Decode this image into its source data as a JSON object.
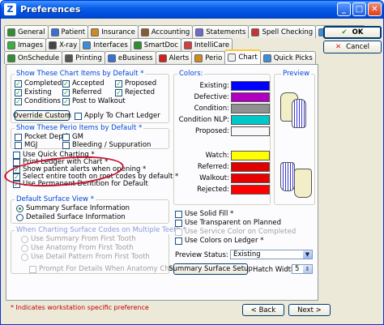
{
  "window": {
    "title": "Preferences",
    "icon_text": "Z"
  },
  "tabs_row1": [
    {
      "label": "General",
      "icon": "general-icon",
      "color": "#2f8f2f"
    },
    {
      "label": "Patient",
      "icon": "patient-icon",
      "color": "#3b6fd8"
    },
    {
      "label": "Insurance",
      "icon": "insurance-icon",
      "color": "#d08a20"
    },
    {
      "label": "Accounting",
      "icon": "accounting-icon",
      "color": "#8a5a2a"
    },
    {
      "label": "Statements",
      "icon": "statements-icon",
      "color": "#6b6bd0"
    },
    {
      "label": "Spell Checking",
      "icon": "spell-check-icon",
      "color": "#c83232"
    },
    {
      "label": "Employer",
      "icon": "employer-icon",
      "color": "#3b8fd8"
    }
  ],
  "tabs_row2": [
    {
      "label": "Images",
      "icon": "images-icon",
      "color": "#3bb03b"
    },
    {
      "label": "X-ray",
      "icon": "xray-icon",
      "color": "#444444"
    },
    {
      "label": "Interfaces",
      "icon": "interfaces-icon",
      "color": "#3b8fd8"
    },
    {
      "label": "SmartDoc",
      "icon": "smartdoc-icon",
      "color": "#2f8f2f"
    },
    {
      "label": "IntelliCare",
      "icon": "intellicare-icon",
      "color": "#d04040"
    }
  ],
  "tabs_row3": [
    {
      "label": "OnSchedule",
      "icon": "onschedule-icon",
      "color": "#2f8f2f"
    },
    {
      "label": "Printing",
      "icon": "printer-icon",
      "color": "#555555"
    },
    {
      "label": "eBusiness",
      "icon": "ebusiness-icon",
      "color": "#3b6fd8"
    },
    {
      "label": "Alerts",
      "icon": "alert-icon",
      "color": "#d02020"
    },
    {
      "label": "Perio",
      "icon": "perio-icon",
      "color": "#d08a20"
    },
    {
      "label": "Chart",
      "icon": "chart-icon",
      "color": "#f0f0f0"
    },
    {
      "label": "Quick Picks",
      "icon": "quick-picks-icon",
      "color": "#3b8fd8"
    }
  ],
  "chart_items": {
    "title": "Show These Chart Items by Default *",
    "items": [
      {
        "label": "Completed",
        "checked": true
      },
      {
        "label": "Accepted",
        "checked": true
      },
      {
        "label": "Proposed",
        "checked": true
      },
      {
        "label": "Existing",
        "checked": true
      },
      {
        "label": "Referred",
        "checked": true
      },
      {
        "label": "Rejected",
        "checked": true
      },
      {
        "label": "Conditions",
        "checked": true
      },
      {
        "label": "Post to Walkout",
        "checked": true
      }
    ],
    "override_label": "Override Custom",
    "apply_label": "Apply To Chart Ledger"
  },
  "perio_items": {
    "title": "Show These Perio Items by Default *",
    "items": [
      {
        "label": "Pocket Depth"
      },
      {
        "label": "GM"
      },
      {
        "label": "MGJ"
      },
      {
        "label": "Bleeding / Suppuration"
      }
    ]
  },
  "options": [
    {
      "label": "Use Quick Charting *",
      "checked": false
    },
    {
      "label": "Print Ledger with Chart *",
      "checked": false
    },
    {
      "label": "Show patient alerts when opening *",
      "checked": true
    },
    {
      "label": "Select entire tooth on root codes by default *",
      "checked": true
    },
    {
      "label": "Use Permanent Dentition for Default",
      "checked": true
    }
  ],
  "surface_view": {
    "title": "Default Surface View *",
    "options": [
      {
        "label": "Summary Surface Information",
        "selected": true
      },
      {
        "label": "Detailed Surface Information",
        "selected": false
      }
    ]
  },
  "multi_teeth": {
    "title": "When Charting Surface Codes on Multiple Teeth *",
    "options": [
      {
        "label": "Use Summary From First Tooth"
      },
      {
        "label": "Use Anatomy From First Tooth"
      },
      {
        "label": "Use Detail Pattern From First Tooth"
      }
    ],
    "prompt_label": "Prompt For Details When Anatomy Changes"
  },
  "colors": {
    "title": "Colors:",
    "items": [
      {
        "label": "Existing:",
        "color": "#0000ff"
      },
      {
        "label": "Defective:",
        "color": "#b000c0"
      },
      {
        "label": "Condition:",
        "color": "#909090"
      },
      {
        "label": "Condition NLP:",
        "color": "#00c8c8"
      },
      {
        "label": "Proposed:",
        "color": "#f8f8f8"
      },
      {
        "label": "Watch:",
        "color": "#ffff00"
      },
      {
        "label": "Referred:",
        "color": "#e00000"
      },
      {
        "label": "Walkout:",
        "color": "#e80000"
      },
      {
        "label": "Rejected:",
        "color": "#ff0000"
      }
    ]
  },
  "preview_label": "Preview",
  "bottom_checks": [
    {
      "label": "Use Solid Fill *",
      "checked": false,
      "disabled": false
    },
    {
      "label": "Use Transparent on Planned",
      "checked": false,
      "disabled": false
    },
    {
      "label": "Use Service Color on Completed",
      "checked": false,
      "disabled": true
    },
    {
      "label": "Use Colors on Ledger *",
      "checked": false,
      "disabled": false
    }
  ],
  "preview_status": {
    "label": "Preview Status:",
    "value": "Existing"
  },
  "summary_button": "Summary Surface Setup",
  "hatch": {
    "label": "Hatch Width:",
    "value": "5"
  },
  "footnote": "* Indicates workstation specific preference",
  "buttons": {
    "ok": "OK",
    "cancel": "Cancel",
    "back": "< Back",
    "next": "Next >"
  }
}
